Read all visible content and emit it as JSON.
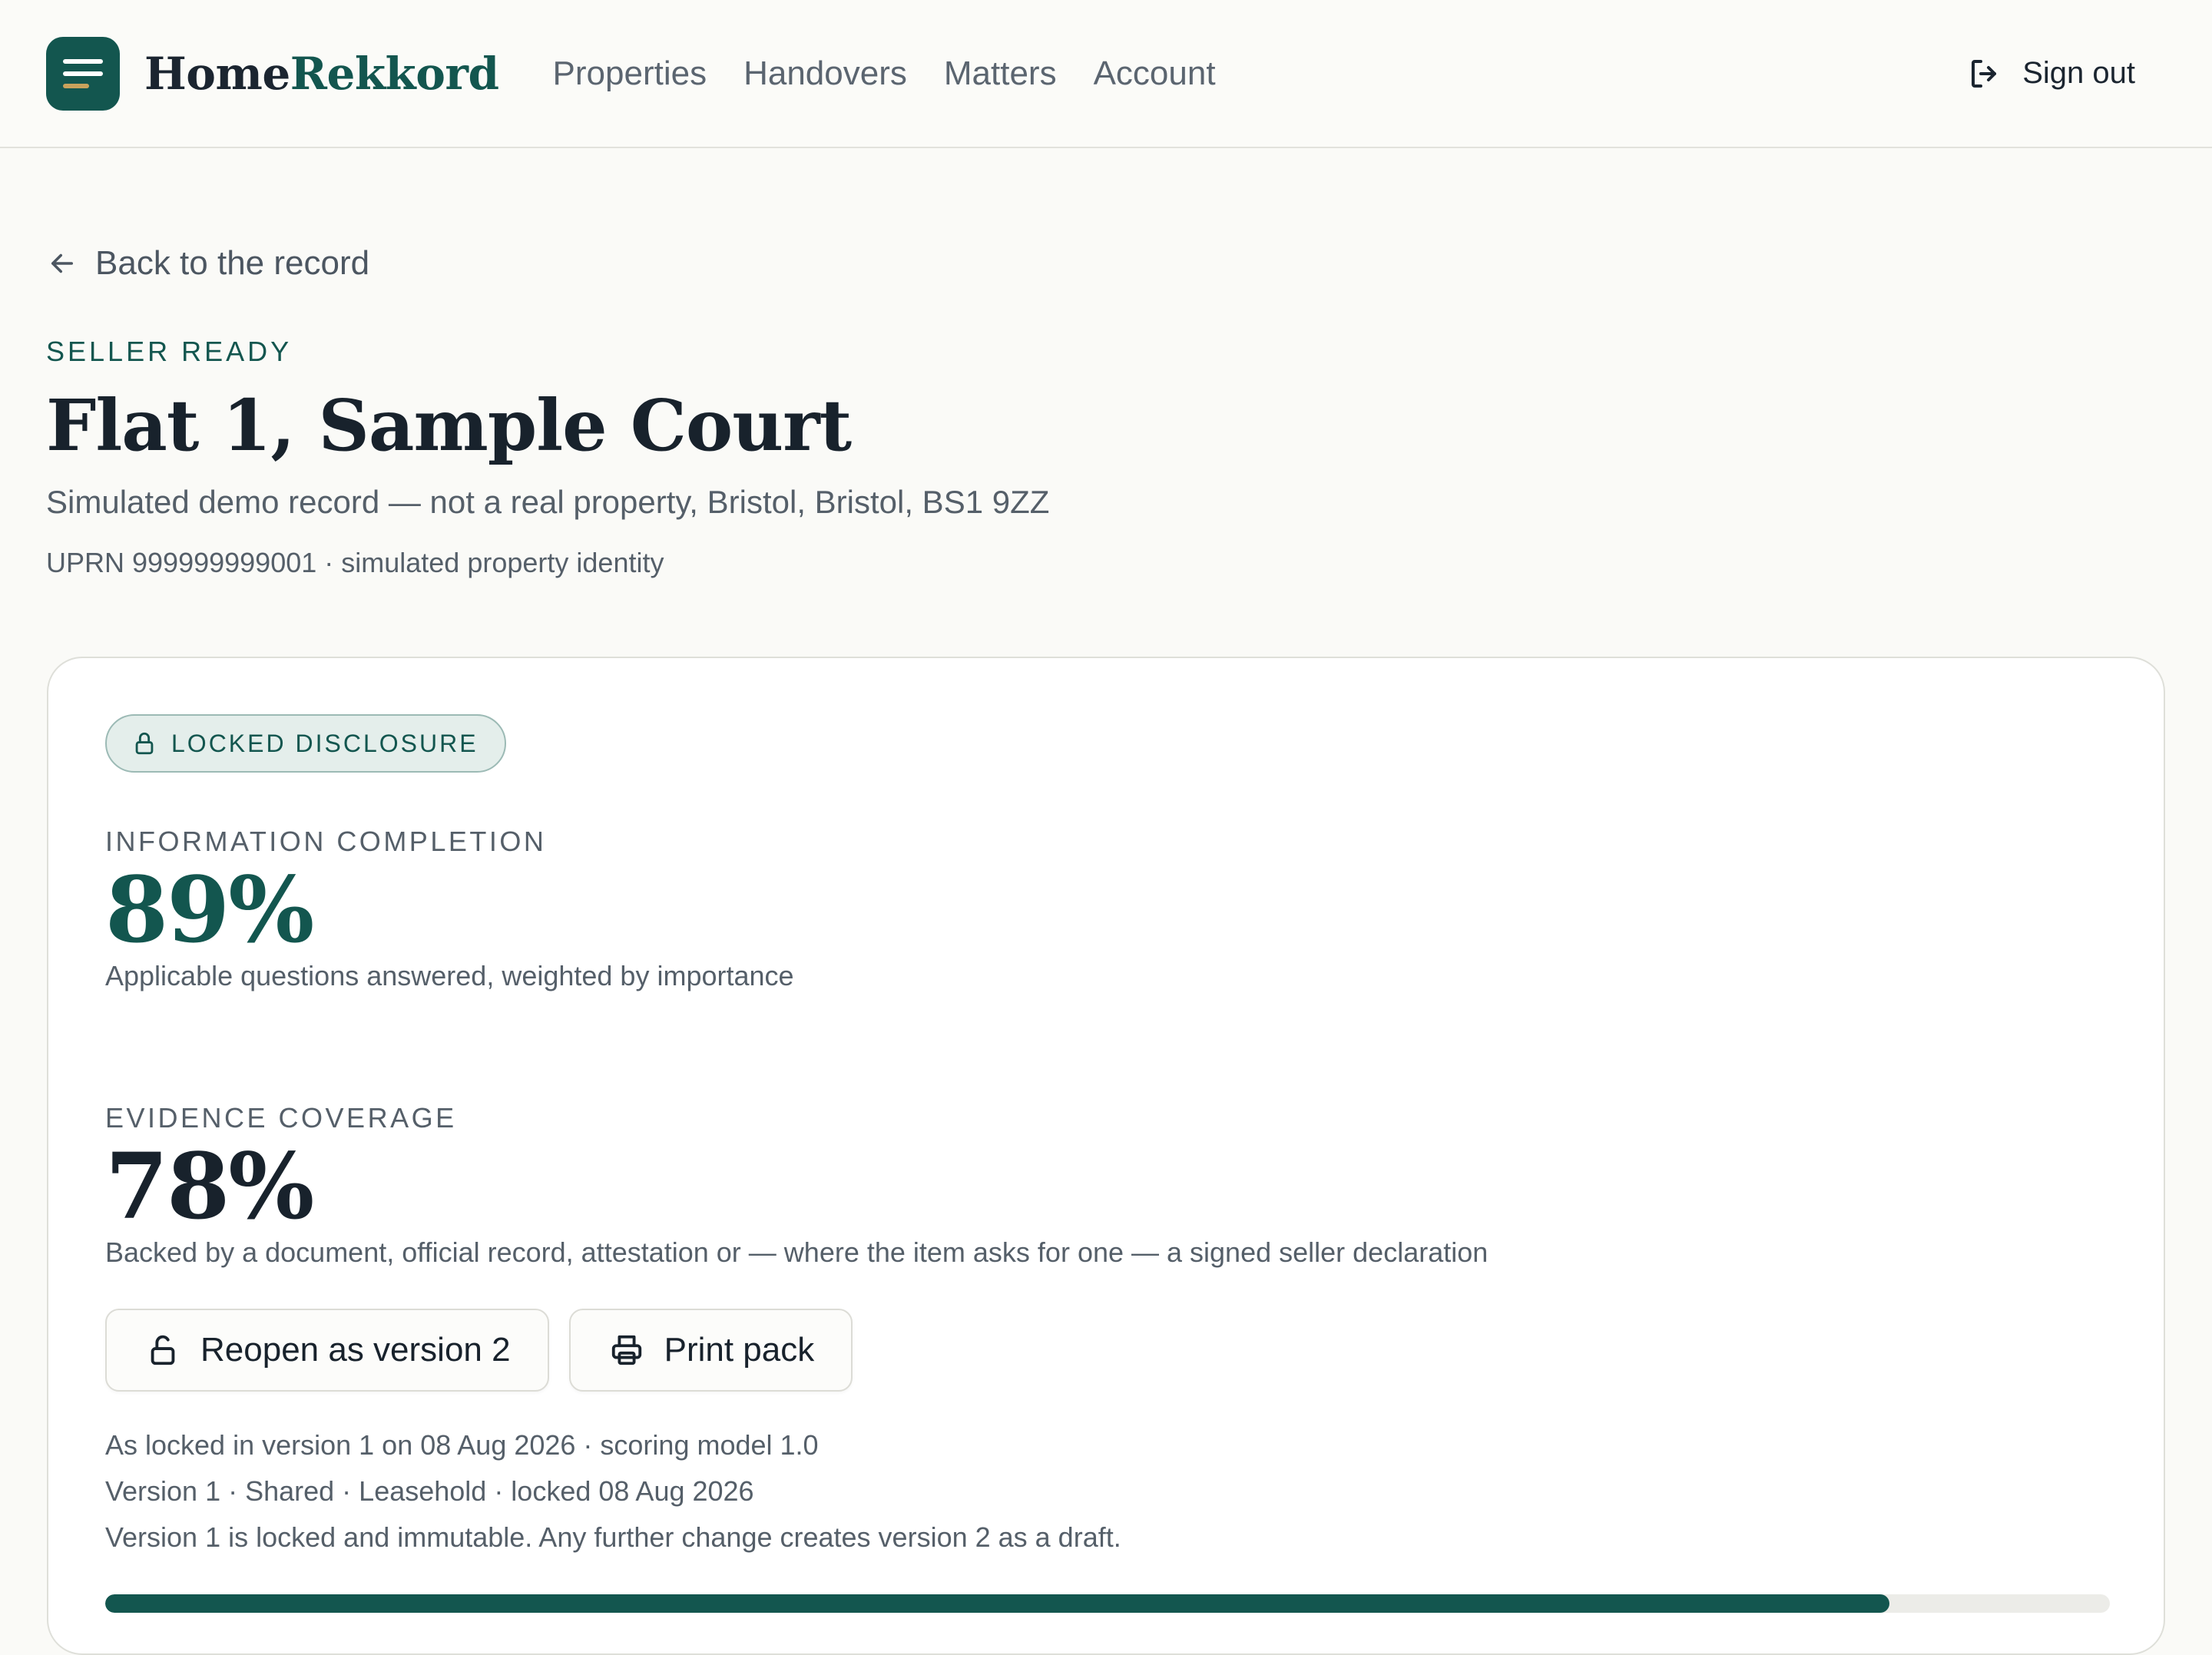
{
  "app": {
    "brand_home": "Home",
    "brand_rekkord": "Rekkord"
  },
  "nav": {
    "links": [
      "Properties",
      "Handovers",
      "Matters",
      "Account"
    ],
    "signout": "Sign out"
  },
  "header": {
    "back": "Back to the record",
    "status": "SELLER READY",
    "title": "Flat 1, Sample Court",
    "address": "Simulated demo record — not a real property, Bristol, Bristol, BS1 9ZZ",
    "uprn": "UPRN 999999999001 · simulated property identity"
  },
  "card": {
    "badge": "LOCKED DISCLOSURE",
    "completion": {
      "label": "INFORMATION COMPLETION",
      "value": "89%",
      "desc": "Applicable questions answered, weighted by importance"
    },
    "evidence": {
      "label": "EVIDENCE COVERAGE",
      "value": "78%",
      "desc": "Backed by a document, official record, attestation or — where the item asks for one — a signed seller declaration"
    },
    "buttons": {
      "reopen": "Reopen as version 2",
      "print": "Print pack"
    },
    "meta": [
      "As locked in version 1 on 08 Aug 2026 · scoring model 1.0",
      "Version 1 · Shared · Leasehold · locked 08 Aug 2026",
      "Version 1 is locked and immutable. Any further change creates version 2 as a draft."
    ],
    "progress_fraction": 0.89
  },
  "colors": {
    "accent": "#13564f",
    "background": "#fafaf7"
  }
}
